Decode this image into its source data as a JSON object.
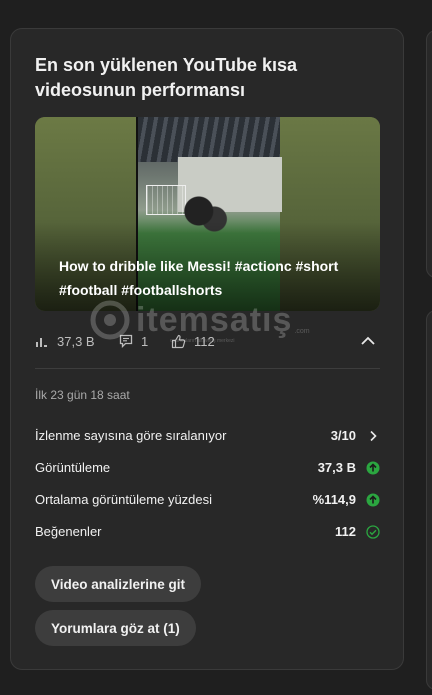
{
  "card": {
    "title": "En son yüklenen YouTube kısa videosunun performansı",
    "video": {
      "caption": "How to dribble like Messi! #actionc #short #football #footballshorts"
    },
    "stats": {
      "views": "37,3 B",
      "comments": "1",
      "likes": "112"
    },
    "period": "İlk 23 gün 18 saat",
    "metrics": [
      {
        "label": "İzlenme sayısına göre sıralanıyor",
        "value": "3/10",
        "icon": "chevron-right-icon"
      },
      {
        "label": "Görüntüleme",
        "value": "37,3 B",
        "icon": "arrow-up-circle-icon"
      },
      {
        "label": "Ortalama görüntüleme yüzdesi",
        "value": "%114,9",
        "icon": "arrow-up-circle-icon"
      },
      {
        "label": "Beğenenler",
        "value": "112",
        "icon": "check-circle-icon"
      }
    ],
    "buttons": {
      "analytics": "Video analizlerine git",
      "comments": "Yorumlara göz at (1)"
    }
  },
  "watermark": {
    "text": "itemsatış",
    "sub": "oyuncuların alışveriş merkezi",
    "domain": ".com"
  },
  "colors": {
    "background": "#1f1f1f",
    "card": "#282828",
    "positive": "#2ba640"
  }
}
